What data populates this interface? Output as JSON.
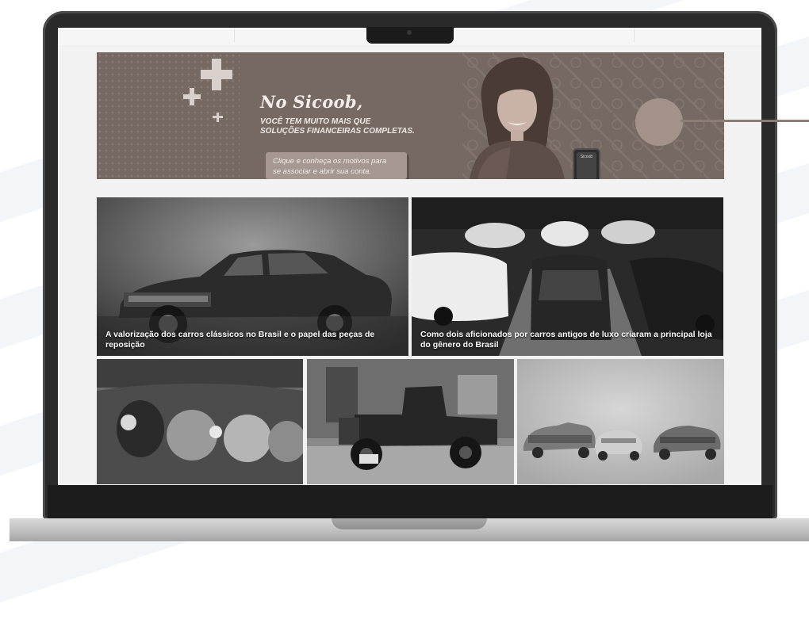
{
  "banner": {
    "headline": "No Sicoob,",
    "subline_1": "VOCÊ TEM MUITO MAIS QUE",
    "subline_2": "SOLUÇÕES FINANCEIRAS COMPLETAS.",
    "cta_line_1": "Clique e conheça os motivos para",
    "cta_line_2": "se associar e abrir sua conta.",
    "phone_label": "Sicoob"
  },
  "articles": [
    {
      "title": "A valorização dos carros clássicos no Brasil e o papel das peças de reposição"
    },
    {
      "title": "Como dois aficionados por carros antigos de luxo criaram a principal loja do gênero do Brasil"
    },
    {
      "title": ""
    },
    {
      "title": ""
    },
    {
      "title": ""
    }
  ],
  "colors": {
    "banner_bg": "#766962",
    "accent_circle": "#a2928a",
    "laptop_frame": "#2a2a2b"
  }
}
